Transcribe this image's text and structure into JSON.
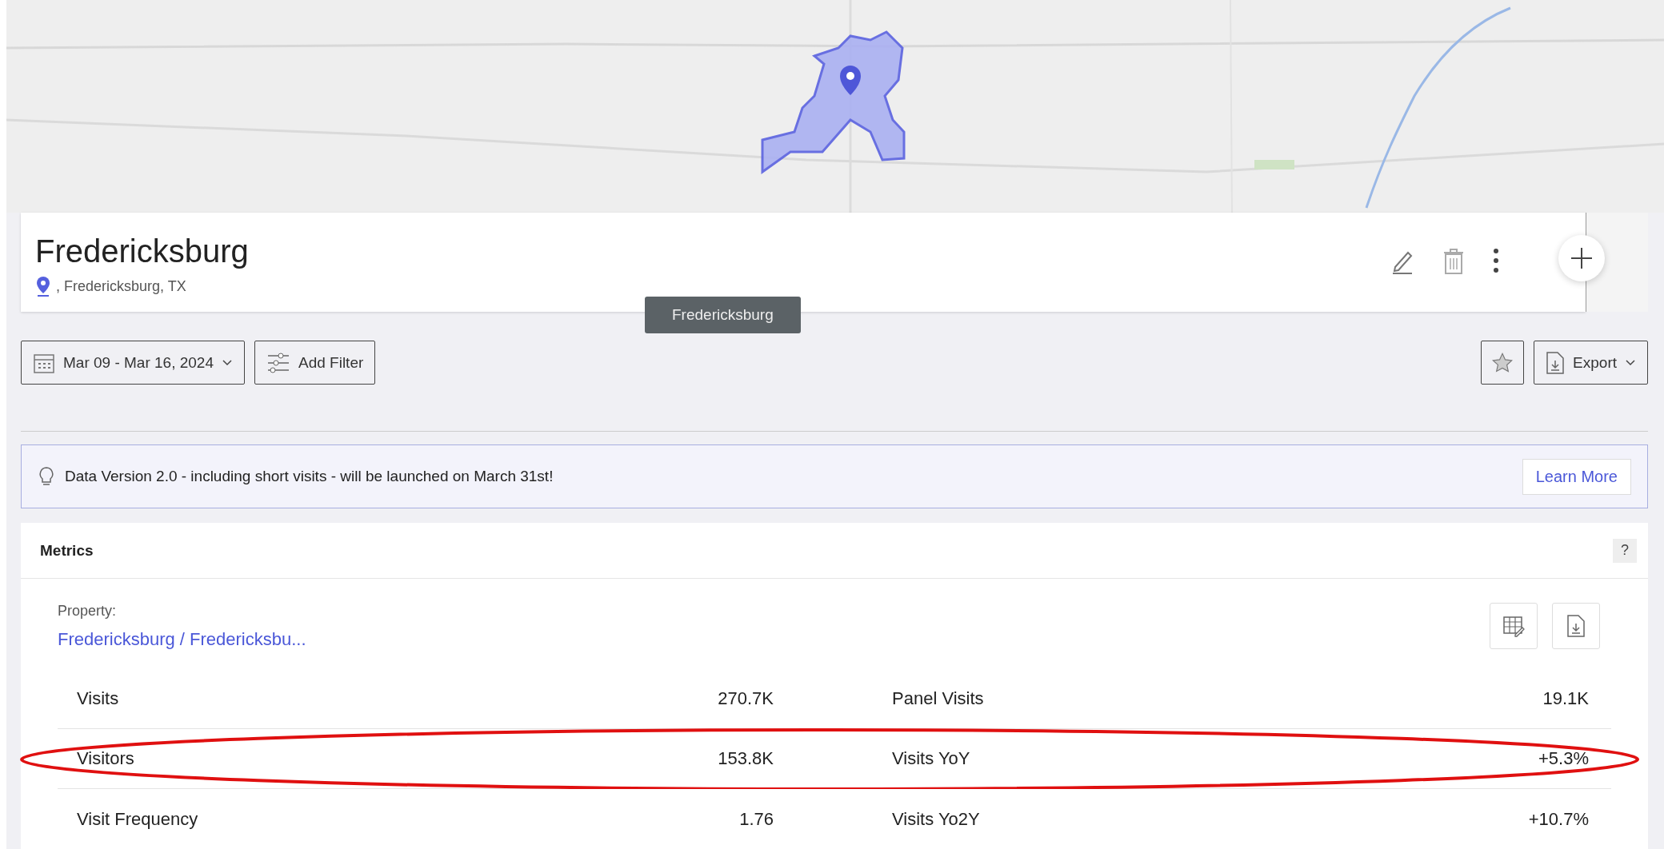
{
  "header": {
    "title": "Fredericksburg",
    "address": ", Fredericksburg, TX"
  },
  "tooltip": "Fredericksburg",
  "toolbar": {
    "date_range": "Mar 09 - Mar 16, 2024",
    "filter_button": "Add Filter",
    "export_button": "Export"
  },
  "banner": {
    "message": "Data Version 2.0 - including short visits - will be launched on March 31st!",
    "action": "Learn More"
  },
  "metrics": {
    "title": "Metrics",
    "help": "?",
    "property_label": "Property:",
    "property_link": "Fredericksburg / Fredericksbu...",
    "rows": [
      {
        "label": "Visits",
        "value": "270.7K",
        "label_2": "Panel Visits",
        "value_2": "19.1K",
        "highlighted": false
      },
      {
        "label": "Visitors",
        "value": "153.8K",
        "label_2": "Visits YoY",
        "value_2": "+5.3%",
        "highlighted": true
      },
      {
        "label": "Visit Frequency",
        "value": "1.76",
        "label_2": "Visits Yo2Y",
        "value_2": "+10.7%",
        "highlighted": false
      }
    ]
  }
}
